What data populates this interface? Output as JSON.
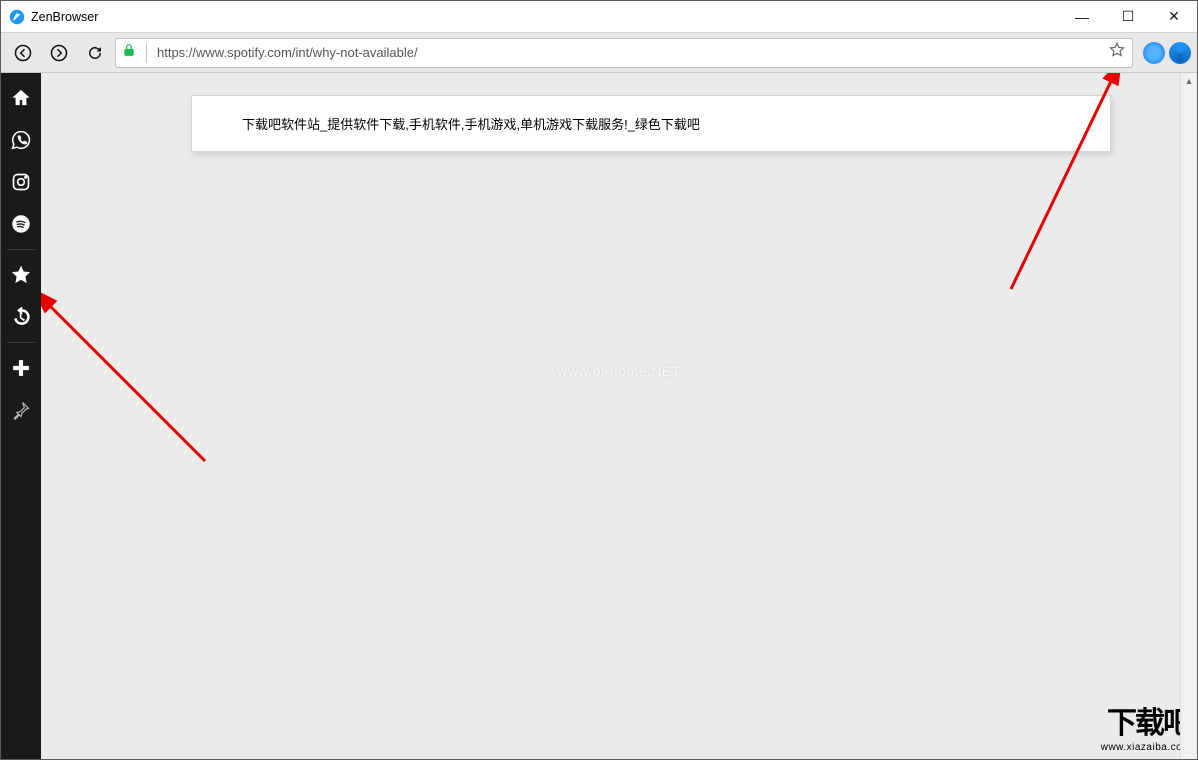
{
  "title": "ZenBrowser",
  "address_url": "https://www.spotify.com/int/why-not-available/",
  "tooltip_text": "下载吧软件站_提供软件下载,手机软件,手机游戏,单机游戏下载服务!_绿色下载吧",
  "watermark_center": "www.pi-home.NET",
  "watermark_brand": "下载吧",
  "watermark_url": "www.xiazaiba.com",
  "win_controls": {
    "min": "—",
    "max": "☐",
    "close": "✕"
  }
}
